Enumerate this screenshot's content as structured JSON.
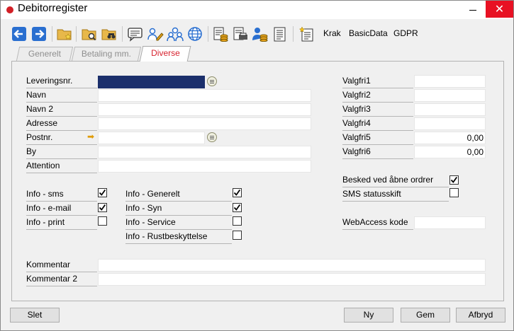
{
  "window": {
    "title": "Debitorregister",
    "close_glyph": "✕"
  },
  "toolbar": {
    "icons": [
      "back-arrow-icon",
      "forward-arrow-icon",
      "new-folder-icon",
      "search-folder-icon",
      "binoculars-folder-icon",
      "message-icon",
      "edit-users-icon",
      "users-icon",
      "globe-icon",
      "ledger-coins-icon",
      "print-ledger-icon",
      "person-coins-icon",
      "document-list-icon",
      "new-document-icon"
    ],
    "krak_label": "Krak",
    "basicdata_label": "BasicData",
    "gdpr_label": "GDPR"
  },
  "tabs": [
    {
      "label": "Generelt",
      "active": false
    },
    {
      "label": "Betaling mm.",
      "active": false
    },
    {
      "label": "Diverse",
      "active": true
    }
  ],
  "form": {
    "leveringsnr_label": "Leveringsnr.",
    "leveringsnr_value": "",
    "navn_label": "Navn",
    "navn_value": "",
    "navn2_label": "Navn 2",
    "navn2_value": "",
    "adresse_label": "Adresse",
    "adresse_value": "",
    "postnr_label": "Postnr.",
    "postnr_value": "",
    "by_label": "By",
    "by_value": "",
    "attention_label": "Attention",
    "attention_value": "",
    "valgfri1_label": "Valgfri1",
    "valgfri1_value": "",
    "valgfri2_label": "Valgfri2",
    "valgfri2_value": "",
    "valgfri3_label": "Valgfri3",
    "valgfri3_value": "",
    "valgfri4_label": "Valgfri4",
    "valgfri4_value": "",
    "valgfri5_label": "Valgfri5",
    "valgfri5_value": "0,00",
    "valgfri6_label": "Valgfri6",
    "valgfri6_value": "0,00",
    "besked_label": "Besked ved åbne ordrer",
    "besked_checked": true,
    "sms_status_label": "SMS statusskift",
    "sms_status_checked": false,
    "webaccess_label": "WebAccess kode",
    "webaccess_value": "",
    "info_sms_label": "Info - sms",
    "info_sms_checked": true,
    "info_email_label": "Info - e-mail",
    "info_email_checked": true,
    "info_print_label": "Info - print",
    "info_print_checked": false,
    "info_generelt_label": "Info - Generelt",
    "info_generelt_checked": true,
    "info_syn_label": "Info - Syn",
    "info_syn_checked": true,
    "info_service_label": "Info - Service",
    "info_service_checked": false,
    "info_rust_label": "Info - Rustbeskyttelse",
    "info_rust_checked": false,
    "kommentar_label": "Kommentar",
    "kommentar_value": "",
    "kommentar2_label": "Kommentar 2",
    "kommentar2_value": ""
  },
  "buttons": {
    "slet": "Slet",
    "ny": "Ny",
    "gem": "Gem",
    "afbryd": "Afbryd"
  },
  "colors": {
    "accent_red": "#d21f26",
    "selected_field": "#1b2f6b",
    "tab_active_text": "#d7232f",
    "icon_blue": "#2a6fd0",
    "icon_orange": "#e8a31d"
  }
}
